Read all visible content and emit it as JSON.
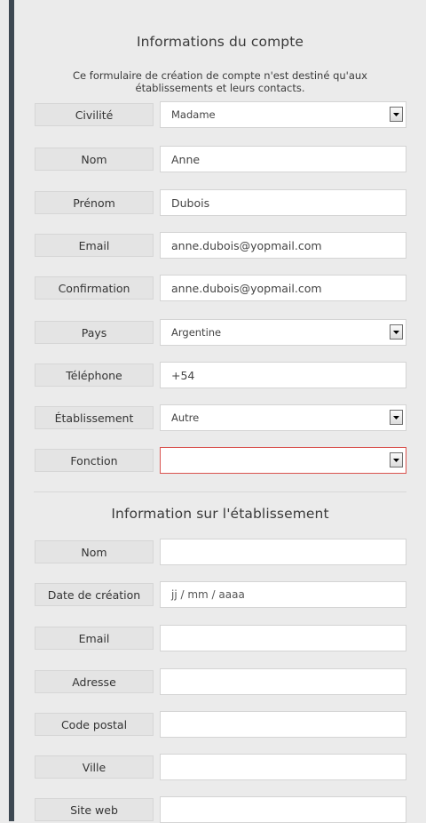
{
  "account_section": {
    "title": "Informations du compte",
    "intro_line1": "Ce formulaire de création de compte n'est destiné qu'aux",
    "intro_line2": "établissements et leurs contacts.",
    "fields": {
      "civilite": {
        "label": "Civilité",
        "value": "Madame"
      },
      "nom": {
        "label": "Nom",
        "value": "Anne"
      },
      "prenom": {
        "label": "Prénom",
        "value": "Dubois"
      },
      "email": {
        "label": "Email",
        "value": "anne.dubois@yopmail.com"
      },
      "confirmation": {
        "label": "Confirmation",
        "value": "anne.dubois@yopmail.com"
      },
      "pays": {
        "label": "Pays",
        "value": "Argentine"
      },
      "telephone": {
        "label": "Téléphone",
        "value": "+54"
      },
      "etablissement": {
        "label": "Établissement",
        "value": "Autre"
      },
      "fonction": {
        "label": "Fonction",
        "value": ""
      }
    }
  },
  "establishment_section": {
    "title": "Information sur l'établissement",
    "fields": {
      "nom": {
        "label": "Nom",
        "value": ""
      },
      "date_creation": {
        "label": "Date de création",
        "placeholder": "jj / mm / aaaa"
      },
      "email": {
        "label": "Email",
        "value": ""
      },
      "adresse": {
        "label": "Adresse",
        "value": ""
      },
      "code_postal": {
        "label": "Code postal",
        "value": ""
      },
      "ville": {
        "label": "Ville",
        "value": ""
      },
      "site_web": {
        "label": "Site web",
        "value": ""
      }
    }
  },
  "icons": {
    "dropdown": "chevron-down-icon"
  },
  "colors": {
    "background": "#ebebeb",
    "sidebar_bar": "#3d4852",
    "label_bg": "#e4e4e4",
    "field_bg": "#ffffff",
    "invalid_border": "#d9534f"
  }
}
